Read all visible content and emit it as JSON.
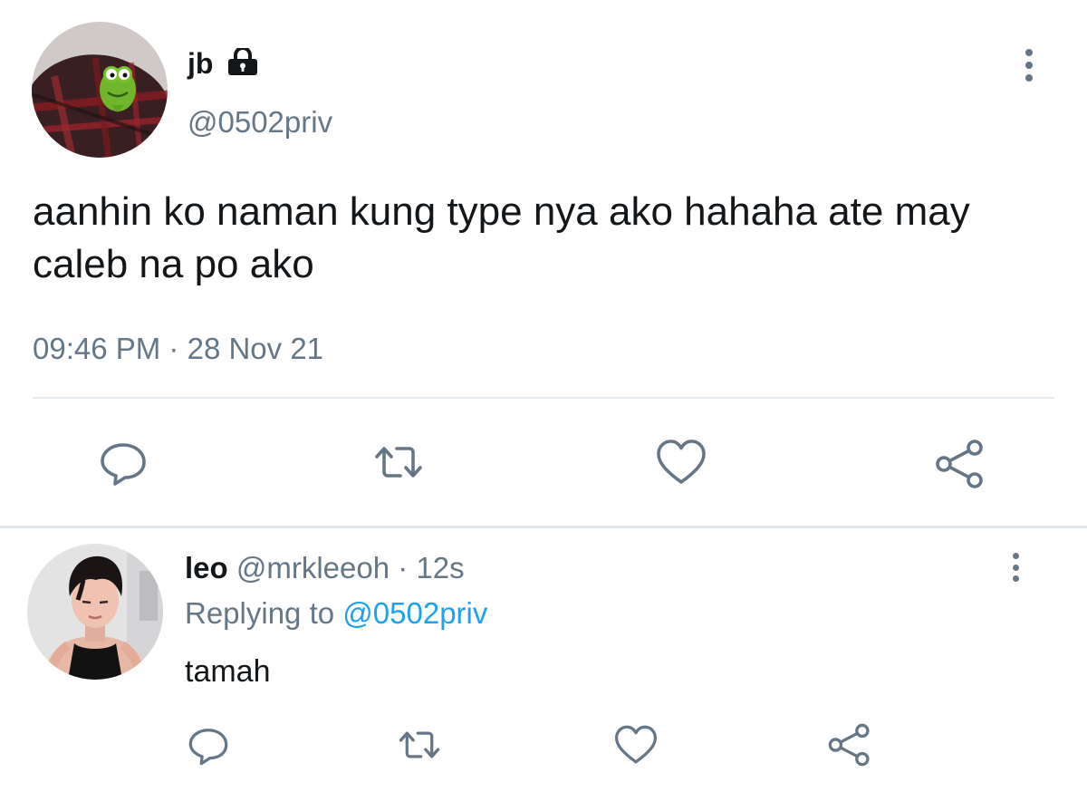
{
  "tweet": {
    "author_name": "jb",
    "author_handle": "@0502priv",
    "text": "aanhin ko naman kung type nya ako hahaha ate may caleb na po ako",
    "time": "09:46 PM",
    "separator": "·",
    "date": "28 Nov 21",
    "icons": {
      "protected": "lock-icon",
      "more": "more-options-icon",
      "reply": "reply-icon",
      "retweet": "retweet-icon",
      "like": "like-icon",
      "share": "share-icon"
    }
  },
  "reply": {
    "author_name": "leo",
    "author_handle": "@mrkleeoh",
    "separator": "·",
    "age": "12s",
    "replying_label": "Replying to",
    "replying_to": "@0502priv",
    "text": "tamah"
  },
  "colors": {
    "text": "#14171a",
    "secondary": "#657786",
    "link": "#1da1f2",
    "divider": "#e6ecf0"
  }
}
